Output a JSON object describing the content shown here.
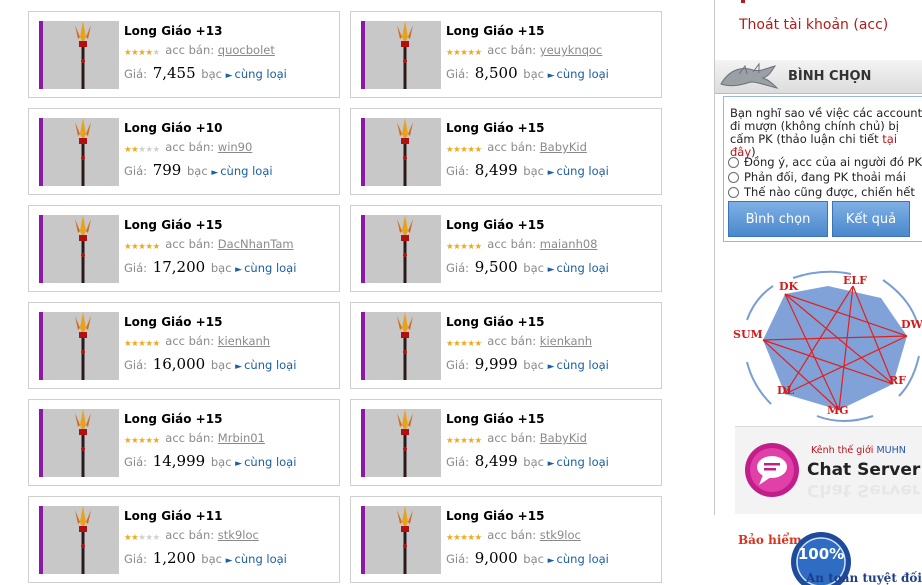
{
  "listings": [
    {
      "title": "Long Giáo +13",
      "stars": 4,
      "seller_label": "acc bán:",
      "seller": "quocbolet",
      "price_label": "Giá:",
      "price": "7,455",
      "unit": "bạc",
      "more": "cùng loại"
    },
    {
      "title": "Long Giáo +15",
      "stars": 5,
      "seller_label": "acc bán:",
      "seller": "yeuyknqoc",
      "price_label": "Giá:",
      "price": "8,500",
      "unit": "bạc",
      "more": "cùng loại"
    },
    {
      "title": "Long Giáo +10",
      "stars": 2,
      "seller_label": "acc bán:",
      "seller": "win90",
      "price_label": "Giá:",
      "price": "799",
      "unit": "bạc",
      "more": "cùng loại"
    },
    {
      "title": "Long Giáo +15",
      "stars": 5,
      "seller_label": "acc bán:",
      "seller": "BabyKid",
      "price_label": "Giá:",
      "price": "8,499",
      "unit": "bạc",
      "more": "cùng loại"
    },
    {
      "title": "Long Giáo +15",
      "stars": 5,
      "seller_label": "acc bán:",
      "seller": "DacNhanTam",
      "price_label": "Giá:",
      "price": "17,200",
      "unit": "bạc",
      "more": "cùng loại"
    },
    {
      "title": "Long Giáo +15",
      "stars": 5,
      "seller_label": "acc bán:",
      "seller": "maianh08",
      "price_label": "Giá:",
      "price": "9,500",
      "unit": "bạc",
      "more": "cùng loại"
    },
    {
      "title": "Long Giáo +15",
      "stars": 5,
      "seller_label": "acc bán:",
      "seller": "kienkanh",
      "price_label": "Giá:",
      "price": "16,000",
      "unit": "bạc",
      "more": "cùng loại"
    },
    {
      "title": "Long Giáo +15",
      "stars": 5,
      "seller_label": "acc bán:",
      "seller": "kienkanh",
      "price_label": "Giá:",
      "price": "9,999",
      "unit": "bạc",
      "more": "cùng loại"
    },
    {
      "title": "Long Giáo +15",
      "stars": 5,
      "seller_label": "acc bán:",
      "seller": "Mrbin01",
      "price_label": "Giá:",
      "price": "14,999",
      "unit": "bạc",
      "more": "cùng loại"
    },
    {
      "title": "Long Giáo +15",
      "stars": 5,
      "seller_label": "acc bán:",
      "seller": "BabyKid",
      "price_label": "Giá:",
      "price": "8,499",
      "unit": "bạc",
      "more": "cùng loại"
    },
    {
      "title": "Long Giáo +11",
      "stars": 2,
      "seller_label": "acc bán:",
      "seller": "stk9loc",
      "price_label": "Giá:",
      "price": "1,200",
      "unit": "bạc",
      "more": "cùng loại"
    },
    {
      "title": "Long Giáo +15",
      "stars": 5,
      "seller_label": "acc bán:",
      "seller": "stk9loc",
      "price_label": "Giá:",
      "price": "9,000",
      "unit": "bạc",
      "more": "cùng loại"
    }
  ],
  "sidebar": {
    "logout": "Thoát tài khoản (acc)",
    "vote": {
      "title": "BÌNH CHỌN",
      "question": "Bạn nghĩ sao về việc các account đi mượn (không chính chủ) bị cấm PK",
      "discuss_prefix": "(thảo luận chi tiết ",
      "discuss_link": "tại đây",
      "discuss_suffix": ")",
      "options": [
        "Đồng ý, acc của ai người đó PK",
        "Phản đối, đang PK thoải mái",
        "Thế nào cũng được, chiến hết"
      ],
      "vote_button": "Bình chọn",
      "result_button": "Kết quả"
    },
    "class_diagram": {
      "labels": [
        "DK",
        "ELF",
        "DW",
        "RF",
        "MG",
        "DL",
        "SUM"
      ]
    },
    "chat_banner": {
      "sub_prefix": "Kênh thế giới",
      "sub_brand": "MUHN",
      "title": "Chat Server"
    },
    "insurance": {
      "text": "Bảo hiểm độ",
      "seal": "100%",
      "sub": "An toàn tuyệt đối"
    }
  },
  "colors": {
    "star": "#f0a81c",
    "thumb_accent": "#8a1aa6",
    "link": "#1a5fa3",
    "logout": "#b41c1c"
  }
}
